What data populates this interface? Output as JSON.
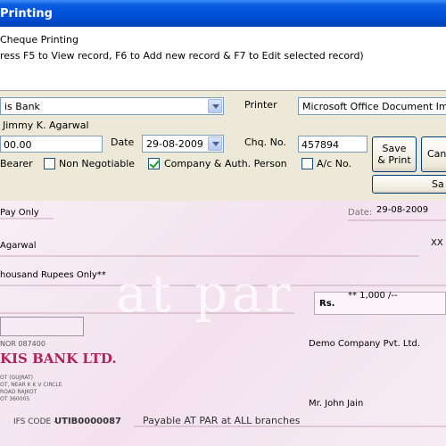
{
  "window": {
    "title": "Printing"
  },
  "info": {
    "heading": "Cheque Printing",
    "hint": "ress F5 to View record, F6 to Add new record & F7 to Edit selected record)"
  },
  "form": {
    "bank_value": "is Bank",
    "printer_label": "Printer",
    "printer_value": "Microsoft Office Document Imag",
    "payee_name": "Jimmy K. Agarwal",
    "amount_value": "00.00",
    "date_label": "Date",
    "date_value": "29-08-2009",
    "chq_label": "Chq. No.",
    "chq_value": "457894",
    "bearer_label": "Bearer",
    "non_negotiable_label": "Non Negotiable",
    "company_auth_label": "Company & Auth. Person",
    "ac_no_label": "A/c No.",
    "save_print_line1": "Save",
    "save_print_line2": "& Print",
    "cancel_label": "Can",
    "save_label": "Sa"
  },
  "checkboxes": {
    "bearer": false,
    "non_negotiable": false,
    "company_auth": true,
    "ac_no": false
  },
  "cheque": {
    "pay_only": "Pay Only",
    "date_label": "Date:",
    "date_value": "29-08-2009",
    "payee": "Agarwal",
    "amount_words": "housand  Rupees Only**",
    "watermark": "at par",
    "rs_label": "Rs.",
    "amount_figure": "** 1,000 /--",
    "micr_line": "NOR    087400",
    "bank_name": "KIS BANK LTD.",
    "address1": "OT (GUJRAT)",
    "address2": "OT, NEAR K K V CIRCLE",
    "address3": "ROAD RAJKOT",
    "address4": "OT 360005",
    "company": "Demo Company Pvt. Ltd.",
    "signatory": "Mr. John Jain",
    "ifs_label": "IFS CODE - ",
    "ifs_value": "UTIB0000087",
    "payable_note": "Payable AT PAR at ALL branches",
    "corner": "XX"
  }
}
